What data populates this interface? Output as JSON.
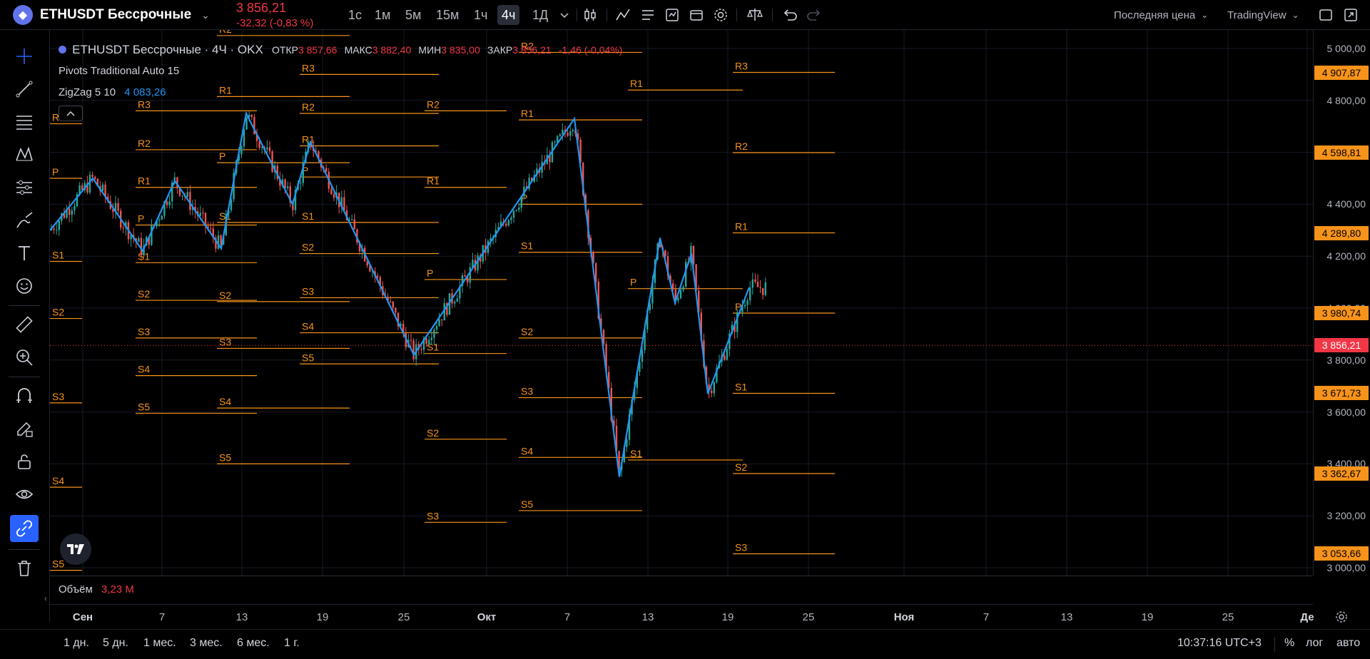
{
  "header": {
    "symbol": "ETHUSDT Бессрочные",
    "price": "3 856,21",
    "change": "-32,32 (-0,83 %)",
    "timeframes": [
      {
        "label": "1с",
        "active": false
      },
      {
        "label": "1м",
        "active": false
      },
      {
        "label": "5м",
        "active": false
      },
      {
        "label": "15м",
        "active": false
      },
      {
        "label": "1ч",
        "active": false
      },
      {
        "label": "4ч",
        "active": true
      },
      {
        "label": "1Д",
        "active": false
      }
    ],
    "price_type": "Последняя цена",
    "chart_source": "TradingView"
  },
  "legend": {
    "title": "ETHUSDT Бессрочные · 4Ч · OKX",
    "open_label": "ОТКР",
    "open": "3 857,66",
    "high_label": "МАКС",
    "high": "3 882,40",
    "low_label": "МИН",
    "low": "3 835,00",
    "close_label": "ЗАКР",
    "close": "3 856,21",
    "close_change": "-1,46 (-0,04%)",
    "pivots_indicator": "Pivots Traditional Auto 15",
    "zigzag_indicator": "ZigZag 5 10",
    "zigzag_value": "4 083,26"
  },
  "volume": {
    "label": "Объём",
    "value": "3,23 M"
  },
  "price_axis": {
    "ticks": [
      "5 000,00",
      "4 800,00",
      "4 600,00",
      "4 400,00",
      "4 200,00",
      "4 000,00",
      "3 800,00",
      "3 600,00",
      "3 400,00",
      "3 200,00",
      "3 000,00"
    ],
    "labels": [
      {
        "text": "4 907,87",
        "price": 4907.87,
        "color": "#f7931a"
      },
      {
        "text": "4 598,81",
        "price": 4598.81,
        "color": "#f7931a"
      },
      {
        "text": "4 289,80",
        "price": 4289.8,
        "color": "#f7931a"
      },
      {
        "text": "3 980,74",
        "price": 3980.74,
        "color": "#f7931a"
      },
      {
        "text": "3 856,21",
        "price": 3856.21,
        "color": "#f23645"
      },
      {
        "text": "3 671,73",
        "price": 3671.73,
        "color": "#f7931a"
      },
      {
        "text": "3 362,67",
        "price": 3362.67,
        "color": "#f7931a"
      },
      {
        "text": "3 053,66",
        "price": 3053.66,
        "color": "#f7931a"
      }
    ]
  },
  "time_axis": {
    "ticks": [
      {
        "label": "Сен",
        "bold": true
      },
      {
        "label": "7",
        "bold": false
      },
      {
        "label": "13",
        "bold": false
      },
      {
        "label": "19",
        "bold": false
      },
      {
        "label": "25",
        "bold": false
      },
      {
        "label": "Окт",
        "bold": true
      },
      {
        "label": "7",
        "bold": false
      },
      {
        "label": "13",
        "bold": false
      },
      {
        "label": "19",
        "bold": false
      },
      {
        "label": "25",
        "bold": false
      },
      {
        "label": "Ноя",
        "bold": true
      },
      {
        "label": "7",
        "bold": false
      },
      {
        "label": "13",
        "bold": false
      },
      {
        "label": "19",
        "bold": false
      },
      {
        "label": "25",
        "bold": false
      },
      {
        "label": "Де",
        "bold": true
      }
    ]
  },
  "bottom": {
    "ranges": [
      "1 дн.",
      "5 дн.",
      "1 мес.",
      "3 мес.",
      "6 мес.",
      "1 г."
    ],
    "time": "10:37:16 UTC+3",
    "percent": "%",
    "log": "лог",
    "auto": "авто"
  },
  "pivots": [
    {
      "period": 1,
      "levels": [
        {
          "n": "R1",
          "v": 4710
        },
        {
          "n": "P",
          "v": 4500
        },
        {
          "n": "S1",
          "v": 4180
        },
        {
          "n": "S2",
          "v": 3960
        },
        {
          "n": "S3",
          "v": 3635
        },
        {
          "n": "S4",
          "v": 3310
        },
        {
          "n": "S5",
          "v": 2990
        }
      ]
    },
    {
      "period": 2,
      "levels": [
        {
          "n": "R3",
          "v": 4760
        },
        {
          "n": "R2",
          "v": 4610
        },
        {
          "n": "R1",
          "v": 4465
        },
        {
          "n": "P",
          "v": 4320
        },
        {
          "n": "S1",
          "v": 4175
        },
        {
          "n": "S2",
          "v": 4030
        },
        {
          "n": "S3",
          "v": 3885
        },
        {
          "n": "S4",
          "v": 3740
        },
        {
          "n": "S5",
          "v": 3595
        }
      ]
    },
    {
      "period": 3,
      "levels": [
        {
          "n": "R2",
          "v": 5050
        },
        {
          "n": "R1",
          "v": 4815
        },
        {
          "n": "P",
          "v": 4560
        },
        {
          "n": "S1",
          "v": 4330
        },
        {
          "n": "S2",
          "v": 4025
        },
        {
          "n": "S3",
          "v": 3845
        },
        {
          "n": "S4",
          "v": 3615
        },
        {
          "n": "S5",
          "v": 3400
        }
      ]
    },
    {
      "period": 4,
      "levels": [
        {
          "n": "R3",
          "v": 4900
        },
        {
          "n": "R2",
          "v": 4750
        },
        {
          "n": "R1",
          "v": 4625
        },
        {
          "n": "P",
          "v": 4505
        },
        {
          "n": "S1",
          "v": 4330
        },
        {
          "n": "S2",
          "v": 4210
        },
        {
          "n": "S3",
          "v": 4040
        },
        {
          "n": "S4",
          "v": 3905
        },
        {
          "n": "S5",
          "v": 3785
        }
      ]
    },
    {
      "period": 5,
      "levels": [
        {
          "n": "R2",
          "v": 4760
        },
        {
          "n": "R1",
          "v": 4465
        },
        {
          "n": "P",
          "v": 4110
        },
        {
          "n": "S1",
          "v": 3825
        },
        {
          "n": "S2",
          "v": 3495
        },
        {
          "n": "S3",
          "v": 3175
        }
      ]
    },
    {
      "period": 6,
      "levels": [
        {
          "n": "R2",
          "v": 4985
        },
        {
          "n": "R1",
          "v": 4725
        },
        {
          "n": "P",
          "v": 4400
        },
        {
          "n": "S1",
          "v": 4215
        },
        {
          "n": "S2",
          "v": 3885
        },
        {
          "n": "S3",
          "v": 3655
        },
        {
          "n": "S4",
          "v": 3425
        },
        {
          "n": "S5",
          "v": 3220
        }
      ]
    },
    {
      "period": 7,
      "levels": [
        {
          "n": "R1",
          "v": 4840
        },
        {
          "n": "P",
          "v": 4075
        },
        {
          "n": "S1",
          "v": 3415
        }
      ]
    },
    {
      "period": 8,
      "levels": [
        {
          "n": "R3",
          "v": 4907.87
        },
        {
          "n": "R2",
          "v": 4598.81
        },
        {
          "n": "R1",
          "v": 4289.8
        },
        {
          "n": "P",
          "v": 3980.74
        },
        {
          "n": "S1",
          "v": 3671.73
        },
        {
          "n": "S2",
          "v": 3362.67
        },
        {
          "n": "S3",
          "v": 3053.66
        }
      ]
    }
  ],
  "zigzag": [
    4300,
    4500,
    4220,
    4490,
    4230,
    4750,
    4400,
    4640,
    3820,
    4730,
    3350,
    4270,
    4020,
    4210,
    3670,
    4080
  ],
  "candles_desc": "4H candles",
  "colors": {
    "up": "#26a69a",
    "down": "#ef5350",
    "pivot": "#f7931a",
    "zigzag": "#2196f3",
    "last_price": "#f23645",
    "accent": "#2962ff"
  },
  "icons": {
    "left_tools": [
      "crosshair-icon",
      "trendline-icon",
      "fib-icon",
      "pattern-icon",
      "forecast-icon",
      "brush-icon",
      "text-icon",
      "emoji-icon",
      "ruler-icon",
      "zoom-in-icon",
      "magnet-icon",
      "lock-draw-icon",
      "lock-icon",
      "eye-icon",
      "link-icon",
      "trash-icon"
    ]
  }
}
